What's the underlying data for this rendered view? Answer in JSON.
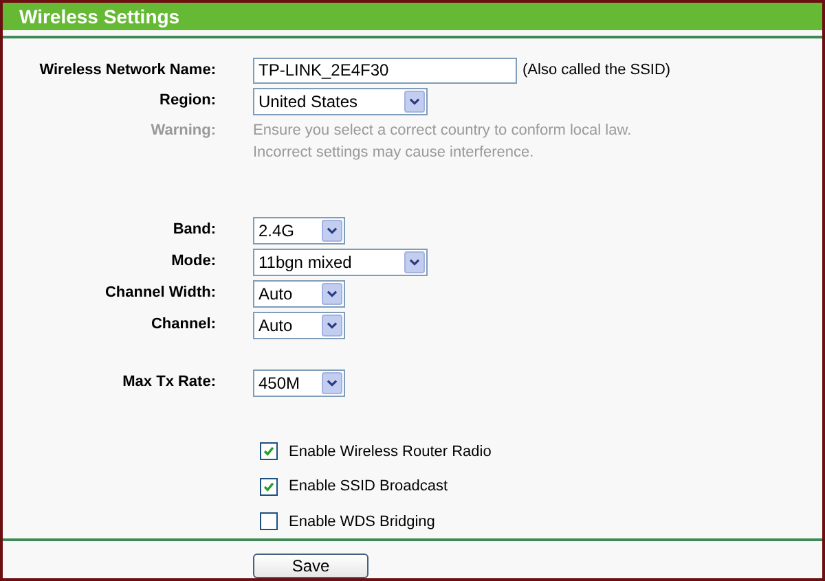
{
  "header": {
    "title": "Wireless Settings"
  },
  "groups": [
    [
      {
        "kind": "text",
        "label": "Wireless Network Name:",
        "value": "TP-LINK_2E4F30",
        "hint": "(Also called the SSID)"
      },
      {
        "kind": "select",
        "label": "Region:",
        "value": "United States"
      },
      {
        "kind": "note",
        "label": "Warning:",
        "lines": [
          "Ensure you select a correct country to conform local law.",
          "Incorrect settings may cause interference."
        ]
      }
    ],
    [
      {
        "kind": "select",
        "label": "Band:",
        "value": "2.4G"
      },
      {
        "kind": "select",
        "label": "Mode:",
        "value": "11bgn mixed"
      },
      {
        "kind": "select",
        "label": "Channel Width:",
        "value": "Auto"
      },
      {
        "kind": "select",
        "label": "Channel:",
        "value": "Auto"
      }
    ],
    [
      {
        "kind": "select",
        "label": "Max Tx Rate:",
        "value": "450M"
      }
    ]
  ],
  "options": [
    {
      "label": "Enable Wireless Router Radio",
      "checked": true
    },
    {
      "label": "Enable SSID Broadcast",
      "checked": true
    },
    {
      "label": "Enable WDS Bridging",
      "checked": false
    }
  ],
  "buttons": [
    "Save"
  ]
}
